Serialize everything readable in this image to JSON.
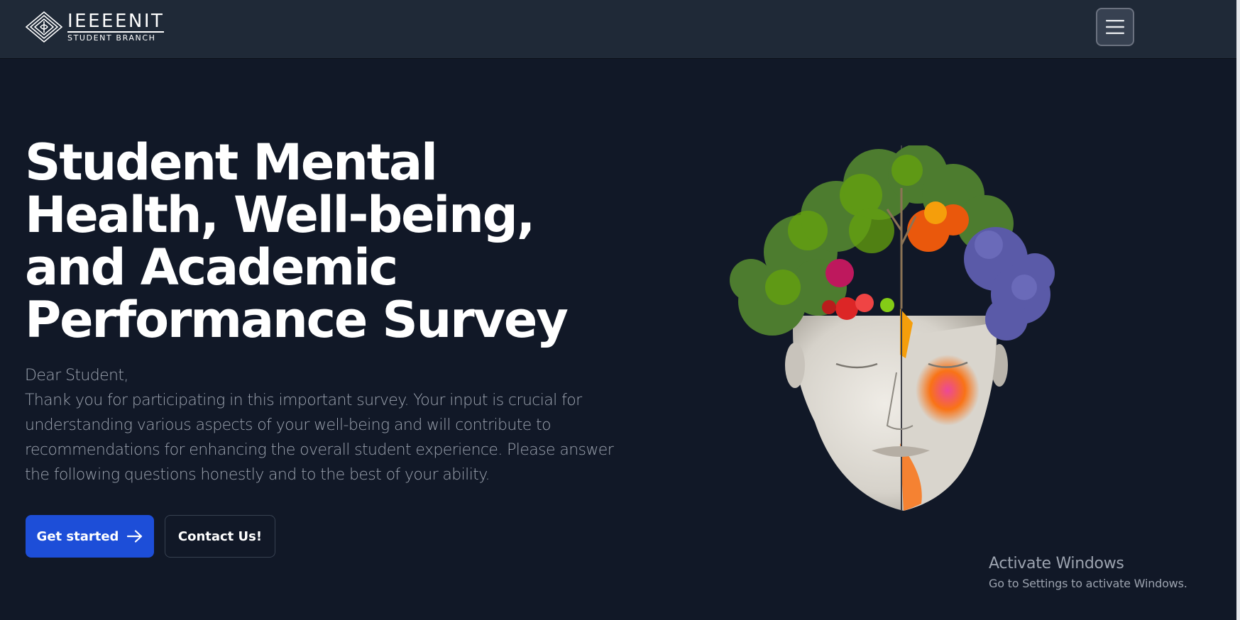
{
  "navbar": {
    "logo_title": "IEEEENIT",
    "logo_subtitle": "STUDENT BRANCH",
    "menu_icon": "hamburger-menu-icon"
  },
  "hero": {
    "title": "Student Mental Health, Well-being, and Academic Performance Survey",
    "greeting": "Dear Student,",
    "body": "Thank you for participating in this important survey. Your input is crucial for understanding various aspects of your well-being and will contribute to recommendations for enhancing the overall student experience. Please answer the following questions honestly and to the best of your ability.",
    "primary_button": "Get started",
    "primary_button_icon": "arrow-right-icon",
    "secondary_button": "Contact Us!"
  },
  "watermark": {
    "title": "Activate Windows",
    "subtitle": "Go to Settings to activate Windows."
  },
  "colors": {
    "background": "#111827",
    "navbar": "#1f2937",
    "primary": "#1d4ed8",
    "body_text": "#9ca3af"
  }
}
